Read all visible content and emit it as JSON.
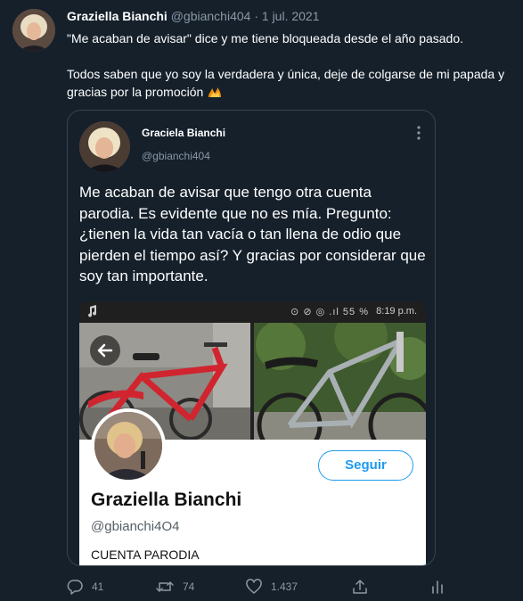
{
  "tweet": {
    "author_name": "Graziella Bianchi",
    "author_handle": "@gbianchi404",
    "date": "· 1 jul. 2021",
    "text_line1": "\"Me acaban de avisar\" dice y me tiene bloqueada desde el año pasado.",
    "text_line2": "Todos saben que yo soy la verdadera y única, deje de colgarse de mi papada y gracias por la promoción",
    "emoji_name": "fire-icon"
  },
  "quoted": {
    "author_name": "Graciela Bianchi",
    "author_handle": "@gbianchi404",
    "text": "Me acaban de avisar que tengo otra cuenta parodia. Es evidente que no es mía. Pregunto: ¿tienen la vida tan vacía o tan llena de odio que pierden el tiempo así? Y gracias por considerar que soy tan importante.",
    "screenshot": {
      "status_icons": "⊙ ⊘ ◎ .ıl 55 %",
      "status_time": "8:19 p.m.",
      "profile_name": "Graziella Bianchi",
      "profile_handle": "@gbianchi4O4",
      "bio": "CUENTA PARODIA",
      "follow_label": "Seguir"
    }
  },
  "actions": {
    "replies": "41",
    "retweets": "74",
    "likes": "1.437"
  },
  "colors": {
    "background": "#15202b",
    "secondary_text": "#8b98a5",
    "accent": "#1d9bf0",
    "border": "#38444d"
  }
}
